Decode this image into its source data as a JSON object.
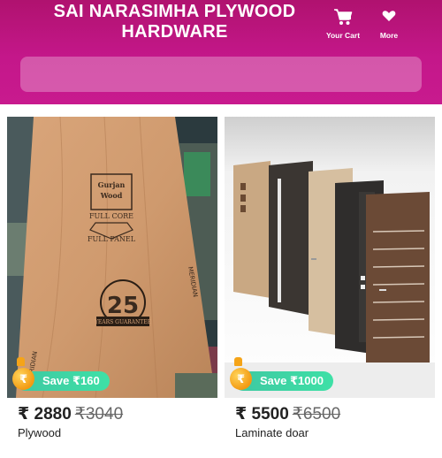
{
  "header": {
    "store_name": "SAI NARASIMHA PLYWOOD HARDWARE",
    "cart_label": "Your Cart",
    "more_label": "More",
    "background_color": "#c4178a"
  },
  "search": {
    "placeholder": ""
  },
  "products": [
    {
      "name": "Plywood",
      "price": "₹ 2880",
      "mrp": "₹3040",
      "save": "Save ₹160",
      "sheet_text": {
        "brand": "Gurjan Wood",
        "core": "FULL CORE",
        "panel": "FULL PANEL",
        "years": "25",
        "guarantee": "YEARS GUARANTEE"
      }
    },
    {
      "name": "Laminate doar",
      "price": "₹ 5500",
      "mrp": "₹6500",
      "save": "Save ₹1000"
    }
  ],
  "badge": {
    "coin_symbol": "₹",
    "color": "#3ec8a2"
  }
}
